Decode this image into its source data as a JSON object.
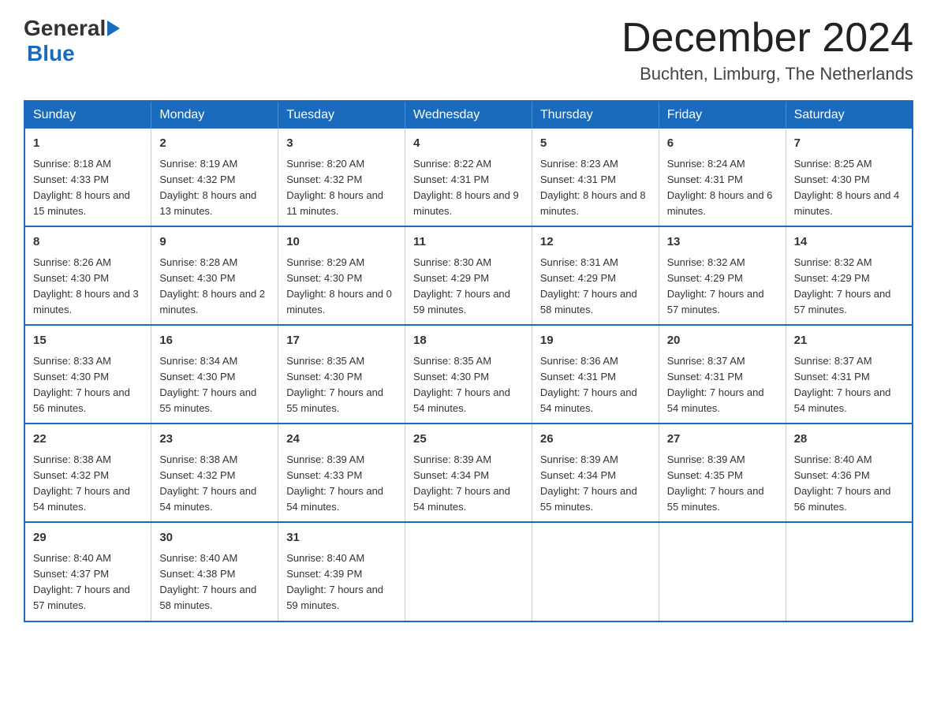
{
  "header": {
    "logo": {
      "text_general": "General",
      "text_blue": "Blue",
      "logo_arrow": "▶"
    },
    "title": "December 2024",
    "location": "Buchten, Limburg, The Netherlands"
  },
  "calendar": {
    "days_of_week": [
      "Sunday",
      "Monday",
      "Tuesday",
      "Wednesday",
      "Thursday",
      "Friday",
      "Saturday"
    ],
    "weeks": [
      [
        {
          "day": "1",
          "sunrise": "Sunrise: 8:18 AM",
          "sunset": "Sunset: 4:33 PM",
          "daylight": "Daylight: 8 hours and 15 minutes."
        },
        {
          "day": "2",
          "sunrise": "Sunrise: 8:19 AM",
          "sunset": "Sunset: 4:32 PM",
          "daylight": "Daylight: 8 hours and 13 minutes."
        },
        {
          "day": "3",
          "sunrise": "Sunrise: 8:20 AM",
          "sunset": "Sunset: 4:32 PM",
          "daylight": "Daylight: 8 hours and 11 minutes."
        },
        {
          "day": "4",
          "sunrise": "Sunrise: 8:22 AM",
          "sunset": "Sunset: 4:31 PM",
          "daylight": "Daylight: 8 hours and 9 minutes."
        },
        {
          "day": "5",
          "sunrise": "Sunrise: 8:23 AM",
          "sunset": "Sunset: 4:31 PM",
          "daylight": "Daylight: 8 hours and 8 minutes."
        },
        {
          "day": "6",
          "sunrise": "Sunrise: 8:24 AM",
          "sunset": "Sunset: 4:31 PM",
          "daylight": "Daylight: 8 hours and 6 minutes."
        },
        {
          "day": "7",
          "sunrise": "Sunrise: 8:25 AM",
          "sunset": "Sunset: 4:30 PM",
          "daylight": "Daylight: 8 hours and 4 minutes."
        }
      ],
      [
        {
          "day": "8",
          "sunrise": "Sunrise: 8:26 AM",
          "sunset": "Sunset: 4:30 PM",
          "daylight": "Daylight: 8 hours and 3 minutes."
        },
        {
          "day": "9",
          "sunrise": "Sunrise: 8:28 AM",
          "sunset": "Sunset: 4:30 PM",
          "daylight": "Daylight: 8 hours and 2 minutes."
        },
        {
          "day": "10",
          "sunrise": "Sunrise: 8:29 AM",
          "sunset": "Sunset: 4:30 PM",
          "daylight": "Daylight: 8 hours and 0 minutes."
        },
        {
          "day": "11",
          "sunrise": "Sunrise: 8:30 AM",
          "sunset": "Sunset: 4:29 PM",
          "daylight": "Daylight: 7 hours and 59 minutes."
        },
        {
          "day": "12",
          "sunrise": "Sunrise: 8:31 AM",
          "sunset": "Sunset: 4:29 PM",
          "daylight": "Daylight: 7 hours and 58 minutes."
        },
        {
          "day": "13",
          "sunrise": "Sunrise: 8:32 AM",
          "sunset": "Sunset: 4:29 PM",
          "daylight": "Daylight: 7 hours and 57 minutes."
        },
        {
          "day": "14",
          "sunrise": "Sunrise: 8:32 AM",
          "sunset": "Sunset: 4:29 PM",
          "daylight": "Daylight: 7 hours and 57 minutes."
        }
      ],
      [
        {
          "day": "15",
          "sunrise": "Sunrise: 8:33 AM",
          "sunset": "Sunset: 4:30 PM",
          "daylight": "Daylight: 7 hours and 56 minutes."
        },
        {
          "day": "16",
          "sunrise": "Sunrise: 8:34 AM",
          "sunset": "Sunset: 4:30 PM",
          "daylight": "Daylight: 7 hours and 55 minutes."
        },
        {
          "day": "17",
          "sunrise": "Sunrise: 8:35 AM",
          "sunset": "Sunset: 4:30 PM",
          "daylight": "Daylight: 7 hours and 55 minutes."
        },
        {
          "day": "18",
          "sunrise": "Sunrise: 8:35 AM",
          "sunset": "Sunset: 4:30 PM",
          "daylight": "Daylight: 7 hours and 54 minutes."
        },
        {
          "day": "19",
          "sunrise": "Sunrise: 8:36 AM",
          "sunset": "Sunset: 4:31 PM",
          "daylight": "Daylight: 7 hours and 54 minutes."
        },
        {
          "day": "20",
          "sunrise": "Sunrise: 8:37 AM",
          "sunset": "Sunset: 4:31 PM",
          "daylight": "Daylight: 7 hours and 54 minutes."
        },
        {
          "day": "21",
          "sunrise": "Sunrise: 8:37 AM",
          "sunset": "Sunset: 4:31 PM",
          "daylight": "Daylight: 7 hours and 54 minutes."
        }
      ],
      [
        {
          "day": "22",
          "sunrise": "Sunrise: 8:38 AM",
          "sunset": "Sunset: 4:32 PM",
          "daylight": "Daylight: 7 hours and 54 minutes."
        },
        {
          "day": "23",
          "sunrise": "Sunrise: 8:38 AM",
          "sunset": "Sunset: 4:32 PM",
          "daylight": "Daylight: 7 hours and 54 minutes."
        },
        {
          "day": "24",
          "sunrise": "Sunrise: 8:39 AM",
          "sunset": "Sunset: 4:33 PM",
          "daylight": "Daylight: 7 hours and 54 minutes."
        },
        {
          "day": "25",
          "sunrise": "Sunrise: 8:39 AM",
          "sunset": "Sunset: 4:34 PM",
          "daylight": "Daylight: 7 hours and 54 minutes."
        },
        {
          "day": "26",
          "sunrise": "Sunrise: 8:39 AM",
          "sunset": "Sunset: 4:34 PM",
          "daylight": "Daylight: 7 hours and 55 minutes."
        },
        {
          "day": "27",
          "sunrise": "Sunrise: 8:39 AM",
          "sunset": "Sunset: 4:35 PM",
          "daylight": "Daylight: 7 hours and 55 minutes."
        },
        {
          "day": "28",
          "sunrise": "Sunrise: 8:40 AM",
          "sunset": "Sunset: 4:36 PM",
          "daylight": "Daylight: 7 hours and 56 minutes."
        }
      ],
      [
        {
          "day": "29",
          "sunrise": "Sunrise: 8:40 AM",
          "sunset": "Sunset: 4:37 PM",
          "daylight": "Daylight: 7 hours and 57 minutes."
        },
        {
          "day": "30",
          "sunrise": "Sunrise: 8:40 AM",
          "sunset": "Sunset: 4:38 PM",
          "daylight": "Daylight: 7 hours and 58 minutes."
        },
        {
          "day": "31",
          "sunrise": "Sunrise: 8:40 AM",
          "sunset": "Sunset: 4:39 PM",
          "daylight": "Daylight: 7 hours and 59 minutes."
        },
        null,
        null,
        null,
        null
      ]
    ]
  }
}
